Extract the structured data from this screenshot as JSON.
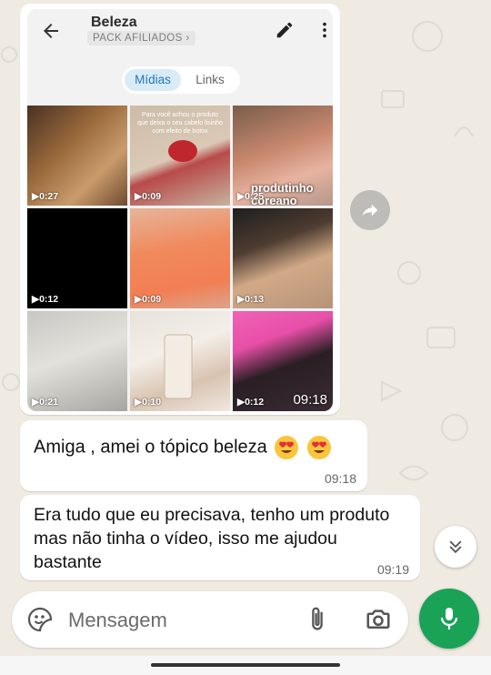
{
  "shared_media": {
    "header": {
      "back_icon": "arrow-left-icon",
      "title": "Beleza",
      "subtitle": "PACK AFILIADOS",
      "subtitle_chevron": "›",
      "edit_icon": "pencil-icon",
      "menu_icon": "more-vert-icon"
    },
    "tabs": [
      {
        "label": "Mídias",
        "selected": true
      },
      {
        "label": "Links",
        "selected": false
      }
    ],
    "media": [
      {
        "duration": "0:27"
      },
      {
        "duration": "0:09",
        "overlay": "Para você achou o produto que deixa o seu cabelo lisinho com efeito de botox"
      },
      {
        "duration": "0:25",
        "overlay": "produtinho coreano"
      },
      {
        "duration": "0:12"
      },
      {
        "duration": "0:09"
      },
      {
        "duration": "0:13"
      },
      {
        "duration": "0:21"
      },
      {
        "duration": "0:10"
      },
      {
        "duration": "0:12",
        "timestamp": "09:18"
      }
    ]
  },
  "forward_icon": "forward-icon",
  "messages": [
    {
      "text": "Amiga , amei o tópico beleza",
      "emojis": [
        "heart-eyes-emoji",
        "heart-eyes-emoji"
      ],
      "time": "09:18"
    },
    {
      "text": "Era tudo que eu precisava, tenho um produto mas não tinha o vídeo, isso me ajudou bastante",
      "time": "09:19"
    }
  ],
  "scroll_down_icon": "double-chevron-down-icon",
  "input_bar": {
    "placeholder": "Mensagem",
    "value": "",
    "emoji_icon": "sticker-smile-icon",
    "attach_icon": "paperclip-icon",
    "camera_icon": "camera-icon",
    "mic_icon": "mic-icon"
  },
  "colors": {
    "chat_background": "#efeae2",
    "accent_green": "#1aa256",
    "tab_selected_bg": "#d9ebf7",
    "tab_selected_text": "#2178b8"
  }
}
